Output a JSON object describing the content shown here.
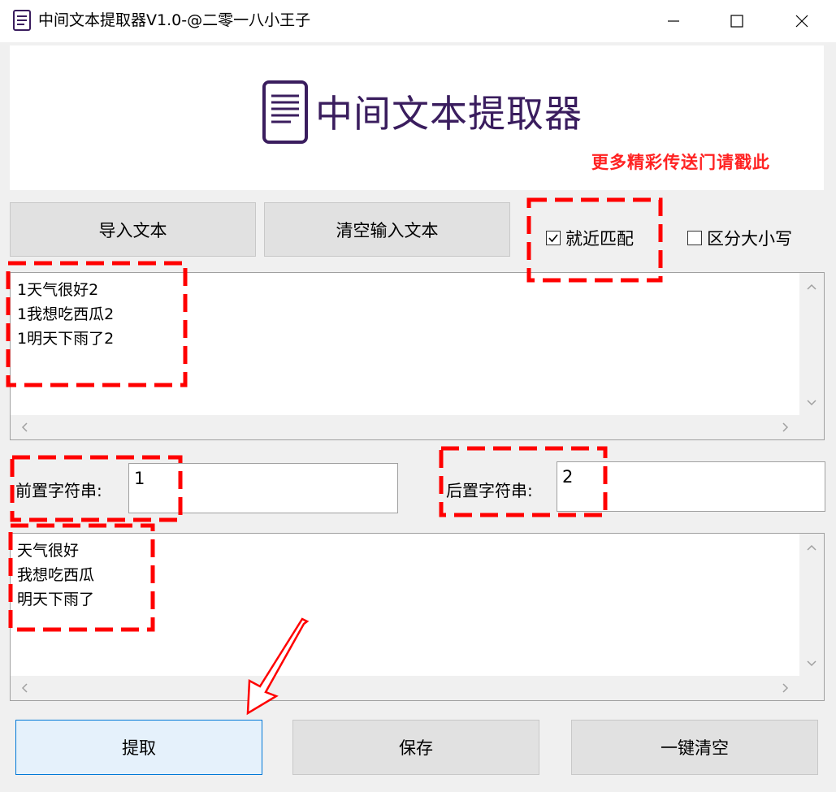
{
  "window": {
    "title": "中间文本提取器V1.0-@二零一八小王子"
  },
  "banner": {
    "title": "中间文本提取器",
    "promo_link": "更多精彩传送门请戳此"
  },
  "toolbar": {
    "import_label": "导入文本",
    "clear_input_label": "清空输入文本"
  },
  "options": {
    "nearest_match": {
      "label": "就近匹配",
      "checked": true
    },
    "case_sensitive": {
      "label": "区分大小写",
      "checked": false
    }
  },
  "input_text": {
    "lines": [
      "1天气很好2",
      "1我想吃西瓜2",
      "1明天下雨了2"
    ]
  },
  "prefix": {
    "label": "前置字符串:",
    "value": "1"
  },
  "suffix": {
    "label": "后置字符串:",
    "value": "2"
  },
  "output_text": {
    "lines": [
      "天气很好",
      "我想吃西瓜",
      "明天下雨了"
    ]
  },
  "actions": {
    "extract_label": "提取",
    "save_label": "保存",
    "clear_all_label": "一键清空"
  },
  "colors": {
    "brand_title": "#3a1d5e",
    "promo": "#ff2222",
    "annotation": "#ff0000",
    "focus_border": "#0078d7"
  }
}
